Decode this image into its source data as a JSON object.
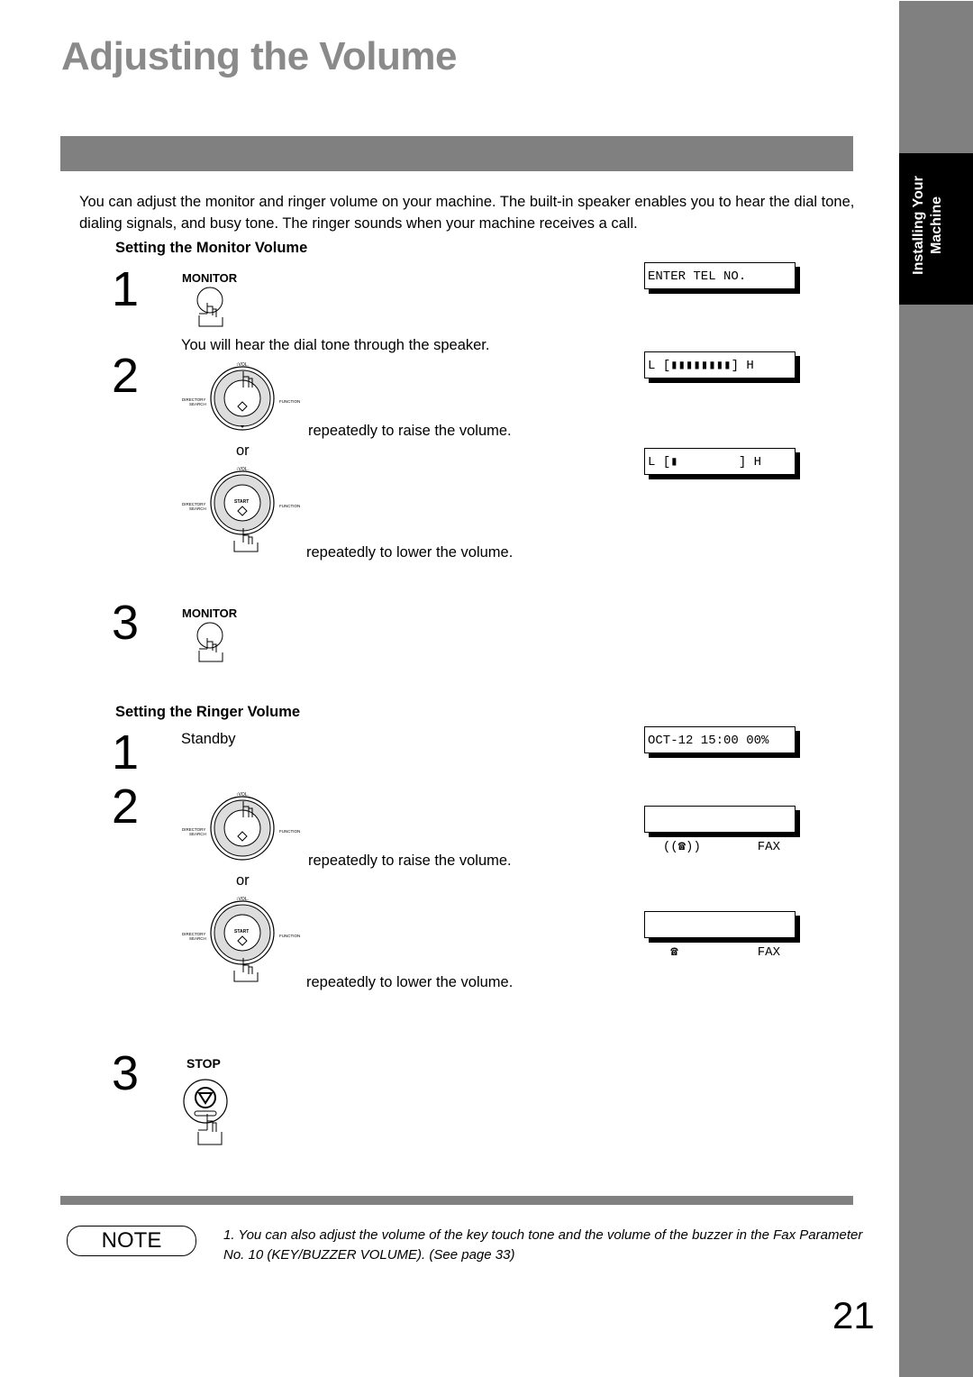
{
  "page": {
    "title": "Adjusting the Volume",
    "side_tab": [
      "Installing Your",
      "Machine"
    ],
    "page_number": "21"
  },
  "intro": "You can adjust the monitor and ringer volume on your machine. The built-in speaker enables you to hear the dial tone, dialing signals, and busy tone. The ringer sounds when your machine receives a call.",
  "monitor_section": {
    "heading": "Setting the Monitor Volume",
    "steps": [
      {
        "num": "1",
        "button": "MONITOR",
        "text": "You will hear the dial tone through the speaker.",
        "display": "ENTER TEL NO."
      },
      {
        "num": "2",
        "raise_text": "repeatedly to raise the volume.",
        "or": "or",
        "lower_text": "repeatedly to lower the volume.",
        "display_high": "L [▮▮▮▮▮▮▮▮] H",
        "display_low": "L [▮        ] H",
        "volume_high_level": 8,
        "volume_low_level": 1
      },
      {
        "num": "3",
        "button": "MONITOR"
      }
    ]
  },
  "ringer_section": {
    "heading": "Setting the Ringer Volume",
    "steps": [
      {
        "num": "1",
        "text": "Standby",
        "display": "OCT-12 15:00 00%"
      },
      {
        "num": "2",
        "raise_text": "repeatedly to raise the volume.",
        "or": "or",
        "lower_text": "repeatedly to lower the volume.",
        "display_high_left": "((☎))",
        "display_high_right": "FAX",
        "display_low_left": " ☎",
        "display_low_right": "FAX"
      },
      {
        "num": "3",
        "button": "STOP"
      }
    ]
  },
  "dial": {
    "vol_label": "↕VOL.",
    "left_label": "DIRECTORY SEARCH",
    "right_label": "FUNCTION",
    "center_label": "START"
  },
  "note": {
    "badge": "NOTE",
    "items": [
      "1.  You can also adjust the volume of the key touch tone and the volume of the buzzer in the Fax Parameter No. 10 (KEY/BUZZER VOLUME).  (See page 33)"
    ]
  }
}
